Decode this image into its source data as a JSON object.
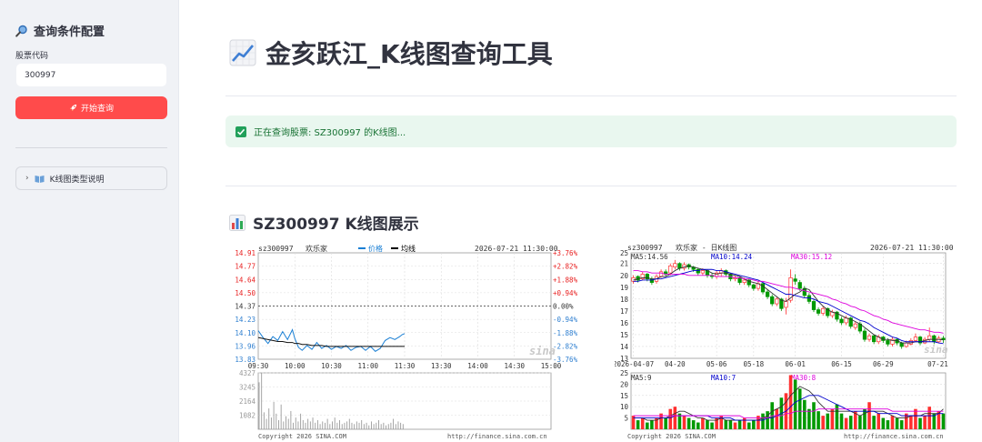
{
  "sidebar": {
    "header": "查询条件配置",
    "input_label": "股票代码",
    "input_value": "300997",
    "button_label": "开始查询",
    "expander_label": "K线图类型说明"
  },
  "main": {
    "title": "金亥跃江_K线图查询工具",
    "alert_text": "正在查询股票: SZ300997 的K线图...",
    "section_title": "SZ300997 K线图展示"
  },
  "colors": {
    "accent": "#ff4b4b",
    "up": "#ff2f2f",
    "down": "#009900",
    "success_bg": "#e9f7ef",
    "success_text": "#177233"
  },
  "chart_data": [
    {
      "type": "line",
      "header": {
        "code": "sz300997",
        "name": "欢乐家",
        "legend_price": "价格",
        "legend_avg": "均线",
        "datetime": "2026-07-21 11:30:00"
      },
      "y_ticks": [
        "14.91",
        "14.77",
        "14.64",
        "14.50",
        "14.37",
        "14.23",
        "14.10",
        "13.96",
        "13.83"
      ],
      "pct_ticks": [
        "+3.76%",
        "+2.82%",
        "+1.88%",
        "+0.94%",
        "0.00%",
        "-0.94%",
        "-1.88%",
        "-2.82%",
        "-3.76%"
      ],
      "x_ticks": [
        "09:30",
        "10:00",
        "10:30",
        "11:00",
        "11:30",
        "13:30",
        "14:00",
        "14:30",
        "15:00"
      ],
      "ylim": [
        13.83,
        14.91
      ],
      "prev_close": 14.37,
      "x_minutes": [
        0,
        4,
        8,
        12,
        16,
        20,
        24,
        28,
        30,
        33,
        36,
        40,
        44,
        48,
        52,
        56,
        60,
        64,
        68,
        72,
        76,
        80,
        84,
        88,
        92,
        96,
        100,
        104,
        108,
        112,
        116,
        118,
        120
      ],
      "price": [
        14.12,
        14.05,
        13.99,
        14.06,
        14.02,
        14.11,
        14.03,
        14.13,
        14.04,
        13.95,
        13.92,
        13.97,
        13.93,
        14.0,
        13.94,
        13.97,
        13.93,
        13.96,
        13.94,
        13.97,
        13.92,
        13.95,
        13.96,
        13.92,
        13.96,
        13.91,
        13.94,
        14.02,
        14.05,
        14.03,
        14.06,
        14.08,
        14.09
      ],
      "avg": [
        14.05,
        14.04,
        14.03,
        14.02,
        14.01,
        14.01,
        14.0,
        14.0,
        13.99,
        13.99,
        13.98,
        13.98,
        13.97,
        13.97,
        13.97,
        13.96,
        13.96,
        13.96,
        13.96,
        13.96,
        13.96,
        13.96,
        13.96,
        13.96,
        13.96,
        13.96,
        13.96,
        13.96,
        13.96,
        13.96,
        13.96,
        13.96,
        13.96
      ],
      "volume_ticks": [
        "4327",
        "3245",
        "2164",
        "1082"
      ],
      "volume": [
        3600,
        4327,
        1300,
        800,
        1600,
        900,
        2100,
        1200,
        700,
        1900,
        600,
        1000,
        800,
        1400,
        500,
        900,
        600,
        1200,
        700,
        500,
        800,
        600,
        900,
        500,
        700,
        400,
        600,
        500,
        800,
        400,
        600,
        900,
        500,
        700,
        400,
        500,
        600,
        800,
        500,
        400,
        600,
        500,
        700,
        400,
        500,
        300,
        600,
        400,
        500,
        700,
        400,
        500,
        300,
        400,
        500,
        800,
        400,
        600,
        500,
        400
      ],
      "footer_left": "Copyright 2026 SINA.COM",
      "footer_right": "http://finance.sina.com.cn",
      "watermark": "sina"
    },
    {
      "type": "candlestick",
      "header": {
        "code": "sz300997",
        "name": "欢乐家 - 日K线图",
        "datetime": "2026-07-21 11:30:00"
      },
      "ma_labels": [
        "MA5:14.56",
        "MA10:14.24",
        "MA30:15.12"
      ],
      "y_ticks": [
        "25",
        "21",
        "20",
        "19",
        "18",
        "17",
        "16",
        "15",
        "14",
        "13"
      ],
      "y_values": [
        21.9,
        21,
        20,
        19,
        18,
        17,
        16,
        15,
        14,
        13
      ],
      "ylim": [
        13,
        21.9
      ],
      "x_ticks": [
        "2026-04-07",
        "04-20",
        "05-06",
        "05-18",
        "06-01",
        "06-15",
        "06-29",
        "07-21"
      ],
      "x_tick_index": [
        0,
        9,
        18,
        26,
        35,
        45,
        54,
        67
      ],
      "close": [
        19.8,
        19.6,
        20.1,
        19.7,
        19.4,
        19.9,
        20.3,
        20.1,
        20.8,
        21.0,
        20.6,
        20.9,
        20.7,
        20.5,
        20.2,
        20.4,
        20.0,
        19.9,
        20.2,
        20.4,
        20.1,
        19.7,
        19.8,
        19.4,
        19.6,
        19.2,
        18.9,
        19.3,
        18.6,
        18.2,
        17.6,
        18.0,
        17.2,
        17.8,
        19.8,
        19.5,
        18.9,
        18.3,
        17.8,
        17.1,
        16.8,
        17.2,
        16.6,
        16.9,
        16.3,
        16.0,
        16.4,
        15.7,
        15.9,
        15.3,
        14.6,
        14.9,
        14.4,
        14.8,
        14.5,
        14.2,
        14.6,
        14.3,
        14.0,
        14.3,
        14.5,
        14.8,
        14.3,
        14.6,
        14.9,
        14.4,
        14.7,
        14.56
      ],
      "open": [
        19.5,
        19.9,
        19.7,
        20.1,
        19.7,
        19.5,
        19.9,
        20.3,
        20.2,
        20.7,
        21.0,
        20.6,
        20.9,
        20.7,
        20.5,
        20.2,
        20.4,
        20.0,
        19.9,
        20.2,
        20.4,
        20.1,
        19.7,
        19.8,
        19.4,
        19.6,
        19.2,
        18.9,
        19.3,
        18.6,
        18.2,
        17.6,
        18.0,
        17.3,
        17.9,
        19.7,
        19.4,
        18.9,
        18.3,
        17.8,
        17.1,
        16.8,
        17.2,
        16.6,
        16.9,
        16.3,
        16.0,
        16.4,
        15.6,
        15.9,
        15.3,
        14.6,
        14.9,
        14.4,
        14.8,
        14.5,
        14.2,
        14.6,
        14.3,
        14.0,
        14.2,
        14.5,
        14.8,
        14.3,
        14.6,
        14.9,
        14.4,
        14.7
      ],
      "high": [
        20.0,
        20.0,
        20.3,
        20.2,
        19.9,
        20.1,
        20.5,
        20.5,
        21.0,
        21.3,
        21.1,
        21.1,
        21.0,
        20.8,
        20.6,
        20.6,
        20.5,
        20.2,
        20.4,
        20.6,
        20.5,
        20.2,
        20.0,
        19.9,
        19.8,
        19.7,
        19.3,
        19.5,
        19.4,
        18.8,
        18.4,
        18.2,
        18.1,
        18.1,
        20.5,
        20.1,
        19.6,
        19.1,
        18.5,
        18.0,
        17.3,
        17.4,
        17.3,
        17.1,
        17.0,
        16.5,
        16.6,
        16.5,
        16.1,
        16.1,
        15.5,
        15.1,
        15.0,
        15.0,
        14.9,
        14.7,
        14.8,
        14.7,
        14.4,
        14.5,
        14.7,
        15.1,
        14.9,
        14.8,
        15.6,
        15.0,
        14.9,
        14.9
      ],
      "low": [
        19.3,
        19.4,
        19.6,
        19.5,
        19.2,
        19.3,
        19.8,
        19.9,
        20.0,
        20.5,
        20.4,
        20.4,
        20.5,
        20.3,
        20.0,
        20.0,
        19.8,
        19.7,
        19.7,
        19.9,
        19.9,
        19.5,
        19.5,
        19.2,
        19.2,
        19.0,
        18.7,
        18.7,
        18.4,
        18.0,
        17.4,
        17.4,
        17.0,
        16.7,
        17.7,
        19.2,
        18.7,
        18.1,
        17.6,
        16.9,
        16.6,
        16.6,
        16.4,
        16.4,
        16.1,
        15.8,
        15.8,
        15.5,
        15.4,
        15.1,
        14.4,
        14.4,
        14.2,
        14.2,
        14.3,
        14.0,
        14.0,
        14.1,
        13.8,
        13.9,
        14.1,
        14.4,
        14.1,
        14.2,
        14.4,
        14.2,
        14.3,
        14.3
      ],
      "ma5": [
        19.6,
        19.7,
        19.8,
        19.8,
        19.7,
        19.7,
        19.9,
        19.9,
        20.1,
        20.4,
        20.6,
        20.7,
        20.8,
        20.7,
        20.6,
        20.5,
        20.4,
        20.2,
        20.1,
        20.2,
        20.2,
        20.1,
        20.0,
        19.9,
        19.7,
        19.5,
        19.4,
        19.3,
        19.1,
        18.8,
        18.5,
        18.2,
        17.9,
        17.8,
        18.1,
        18.4,
        18.6,
        18.9,
        18.8,
        18.3,
        17.8,
        17.4,
        17.1,
        16.9,
        16.8,
        16.6,
        16.4,
        16.3,
        16.1,
        15.9,
        15.6,
        15.3,
        15.0,
        14.8,
        14.6,
        14.6,
        14.5,
        14.5,
        14.3,
        14.3,
        14.3,
        14.4,
        14.4,
        14.5,
        14.6,
        14.6,
        14.6,
        14.56
      ],
      "ma10": [
        19.5,
        19.5,
        19.6,
        19.6,
        19.6,
        19.7,
        19.7,
        19.8,
        19.9,
        20.0,
        20.1,
        20.2,
        20.3,
        20.4,
        20.4,
        20.5,
        20.5,
        20.5,
        20.4,
        20.4,
        20.3,
        20.2,
        20.1,
        20.0,
        19.9,
        19.8,
        19.7,
        19.6,
        19.4,
        19.2,
        19.0,
        18.8,
        18.6,
        18.4,
        18.4,
        18.3,
        18.2,
        18.1,
        18.1,
        18.0,
        17.8,
        17.7,
        17.6,
        17.4,
        17.2,
        17.0,
        16.8,
        16.6,
        16.4,
        16.2,
        16.1,
        15.9,
        15.6,
        15.4,
        15.2,
        15.0,
        14.8,
        14.7,
        14.5,
        14.4,
        14.4,
        14.4,
        14.4,
        14.4,
        14.4,
        14.4,
        14.3,
        14.24
      ],
      "ma30": [
        20.4,
        20.4,
        20.3,
        20.3,
        20.2,
        20.2,
        20.2,
        20.1,
        20.1,
        20.1,
        20.1,
        20.1,
        20.0,
        20.0,
        20.0,
        20.0,
        20.0,
        20.0,
        19.9,
        19.9,
        19.9,
        19.9,
        19.8,
        19.8,
        19.7,
        19.7,
        19.6,
        19.5,
        19.5,
        19.4,
        19.3,
        19.2,
        19.1,
        19.0,
        19.0,
        18.9,
        18.8,
        18.7,
        18.6,
        18.5,
        18.4,
        18.3,
        18.2,
        18.0,
        17.9,
        17.7,
        17.6,
        17.4,
        17.3,
        17.1,
        17.0,
        16.8,
        16.6,
        16.5,
        16.3,
        16.2,
        16.0,
        15.9,
        15.8,
        15.7,
        15.6,
        15.5,
        15.4,
        15.4,
        15.3,
        15.2,
        15.2,
        15.12
      ],
      "vol_labels": [
        "MA5:9",
        "MA10:7",
        "MA30:8"
      ],
      "vol_ticks": [
        "25",
        "20",
        "15",
        "10",
        "5"
      ],
      "vol_tick_values": [
        25,
        20,
        15,
        10,
        5
      ],
      "volume": [
        6,
        4,
        5,
        3,
        4,
        5,
        7,
        5,
        9,
        10,
        7,
        6,
        5,
        4,
        3,
        5,
        4,
        3,
        5,
        6,
        4,
        4,
        3,
        4,
        5,
        3,
        4,
        6,
        7,
        8,
        12,
        9,
        14,
        16,
        24,
        22,
        18,
        13,
        9,
        12,
        8,
        6,
        7,
        9,
        11,
        7,
        5,
        6,
        8,
        6,
        9,
        12,
        6,
        7,
        5,
        4,
        6,
        5,
        4,
        7,
        6,
        9,
        5,
        6,
        10,
        7,
        8,
        7
      ],
      "vol_ma5": [
        5,
        5,
        5,
        4,
        4,
        4,
        5,
        5,
        6,
        7,
        8,
        8,
        7,
        6,
        5,
        5,
        4,
        4,
        4,
        5,
        4,
        4,
        4,
        4,
        4,
        4,
        4,
        4,
        5,
        6,
        8,
        9,
        10,
        12,
        15,
        17,
        19,
        18,
        17,
        15,
        12,
        10,
        8,
        8,
        8,
        8,
        8,
        8,
        7,
        6,
        7,
        8,
        8,
        8,
        8,
        7,
        6,
        5,
        5,
        5,
        6,
        6,
        6,
        7,
        7,
        7,
        7,
        9
      ],
      "vol_ma10": [
        5,
        5,
        5,
        5,
        5,
        5,
        5,
        5,
        5,
        6,
        6,
        6,
        6,
        6,
        6,
        6,
        6,
        5,
        5,
        5,
        5,
        5,
        4,
        4,
        4,
        4,
        4,
        4,
        4,
        5,
        5,
        6,
        7,
        8,
        10,
        12,
        13,
        14,
        15,
        15,
        15,
        14,
        13,
        12,
        11,
        10,
        9,
        8,
        8,
        8,
        8,
        8,
        8,
        7,
        7,
        7,
        7,
        7,
        6,
        6,
        6,
        6,
        6,
        6,
        6,
        6,
        7,
        7
      ],
      "vol_ma30": [
        6,
        6,
        6,
        6,
        6,
        6,
        6,
        6,
        6,
        6,
        6,
        6,
        6,
        6,
        6,
        6,
        6,
        6,
        6,
        6,
        6,
        6,
        6,
        6,
        5,
        5,
        5,
        5,
        5,
        5,
        6,
        6,
        6,
        7,
        7,
        8,
        8,
        8,
        8,
        8,
        9,
        9,
        9,
        9,
        9,
        9,
        9,
        9,
        9,
        9,
        9,
        9,
        9,
        9,
        9,
        9,
        8,
        8,
        8,
        8,
        8,
        8,
        8,
        8,
        8,
        8,
        8,
        8
      ],
      "footer_left": "Copyright 2026 SINA.COM",
      "footer_right": "http://finance.sina.com.cn",
      "watermark": "sina"
    }
  ]
}
